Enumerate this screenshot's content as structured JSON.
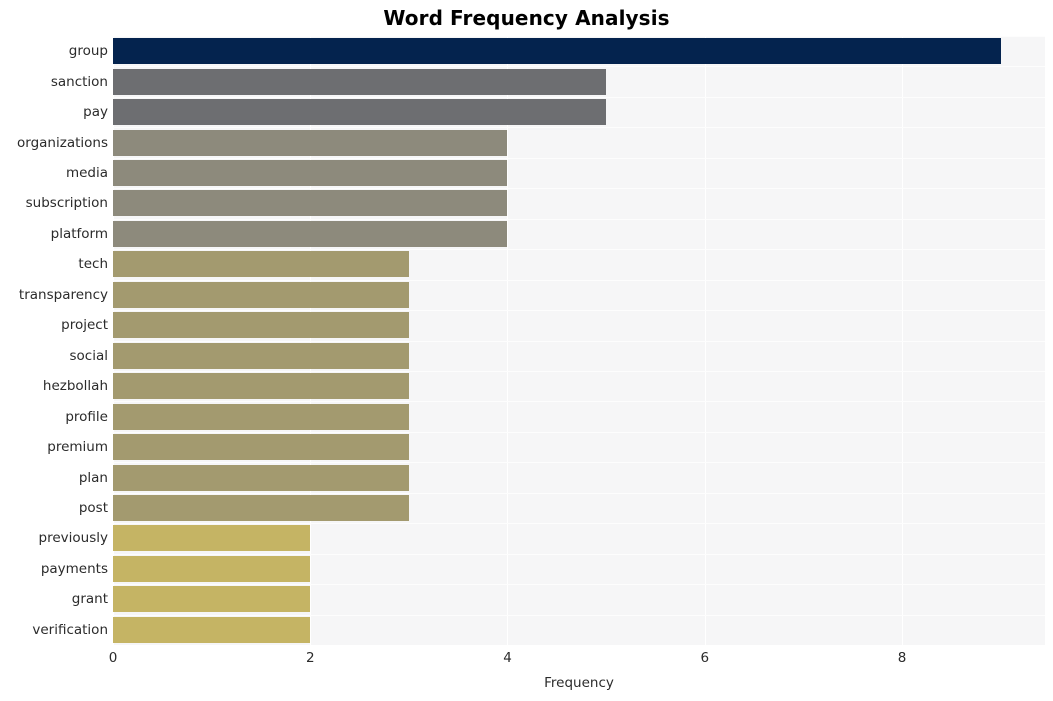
{
  "chart_data": {
    "type": "bar",
    "orientation": "horizontal",
    "title": "Word Frequency Analysis",
    "xlabel": "Frequency",
    "ylabel": "",
    "categories": [
      "group",
      "sanction",
      "pay",
      "organizations",
      "media",
      "subscription",
      "platform",
      "tech",
      "transparency",
      "project",
      "social",
      "hezbollah",
      "profile",
      "premium",
      "plan",
      "post",
      "previously",
      "payments",
      "grant",
      "verification"
    ],
    "values": [
      9,
      5,
      5,
      4,
      4,
      4,
      4,
      3,
      3,
      3,
      3,
      3,
      3,
      3,
      3,
      3,
      2,
      2,
      2,
      2
    ],
    "bar_colors": [
      "#04234e",
      "#6d6e71",
      "#6d6e71",
      "#8d8a7c",
      "#8d8a7c",
      "#8d8a7c",
      "#8d8a7c",
      "#a39a6f",
      "#a39a6f",
      "#a39a6f",
      "#a39a6f",
      "#a39a6f",
      "#a39a6f",
      "#a39a6f",
      "#a39a6f",
      "#a39a6f",
      "#c5b464",
      "#c5b464",
      "#c5b464",
      "#c5b464"
    ],
    "xlim": [
      0,
      9.45
    ],
    "xticks": [
      0,
      2,
      4,
      6,
      8
    ],
    "xticklabels": [
      "0",
      "2",
      "4",
      "6",
      "8"
    ],
    "grid": true,
    "legend": false,
    "plot_background": "#f6f6f7",
    "figure_background": "#ffffff",
    "gridline_color": "#ffffff",
    "title_color": "#000000",
    "tick_label_color": "#2b2b2b"
  }
}
